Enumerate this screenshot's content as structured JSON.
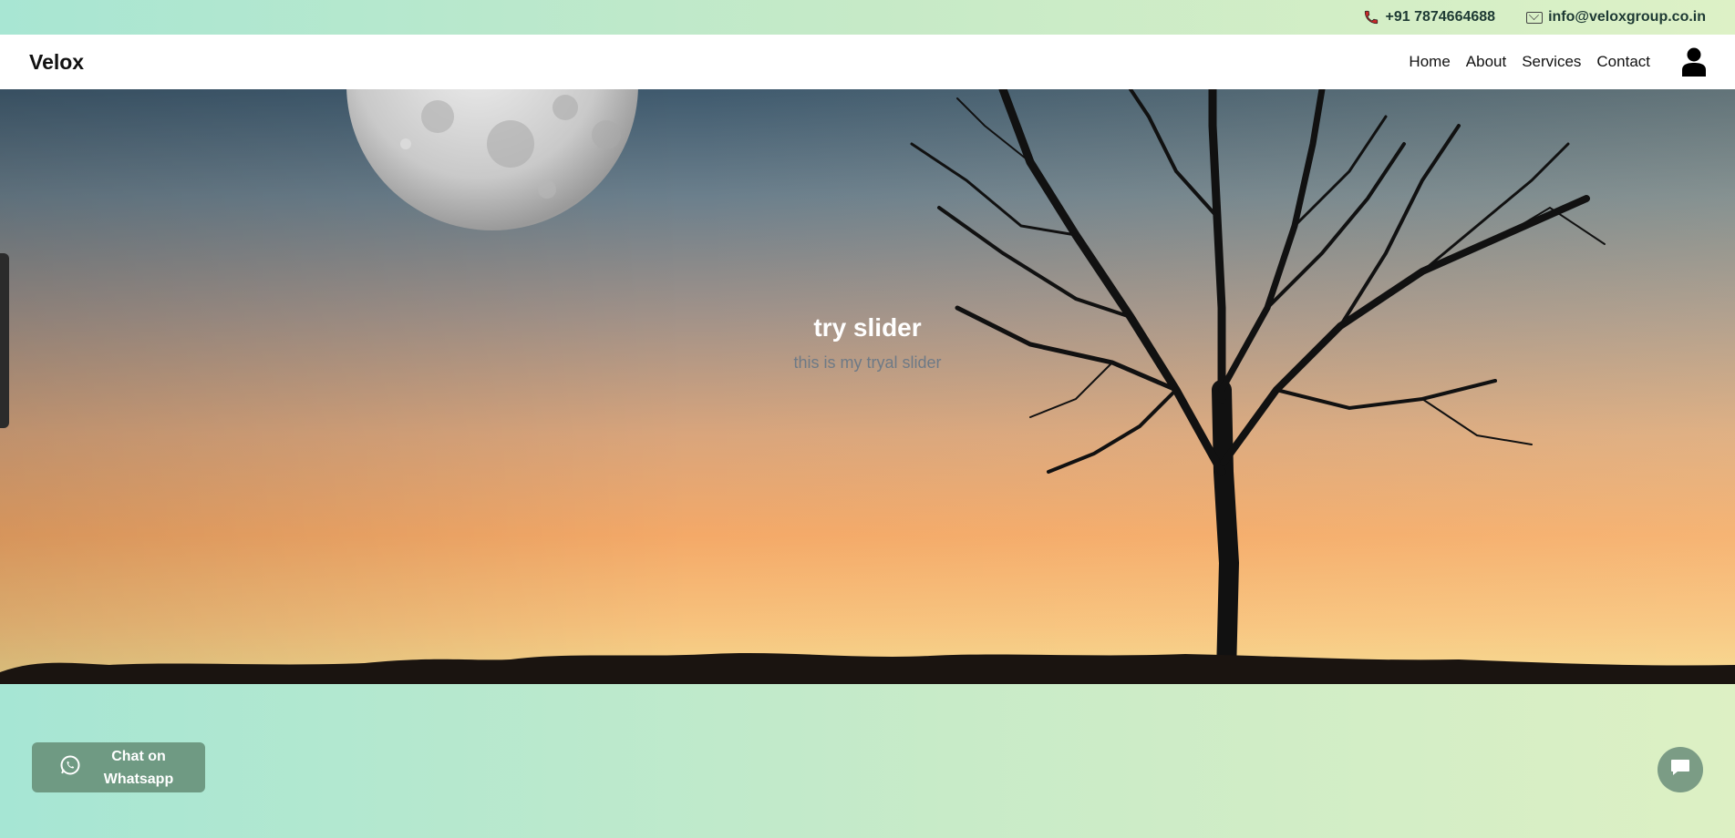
{
  "topbar": {
    "phone": "+91 7874664688",
    "email": "info@veloxgroup.co.in"
  },
  "navbar": {
    "brand": "Velox",
    "links": [
      "Home",
      "About",
      "Services",
      "Contact"
    ]
  },
  "hero": {
    "title": "try slider",
    "subtitle": "this is my tryal slider"
  },
  "whatsapp": {
    "label_line1": "Chat on",
    "label_line2": "Whatsapp"
  },
  "icons": {
    "phone": "phone-icon",
    "email": "mail-icon",
    "user": "user-icon",
    "whatsapp": "whatsapp-icon",
    "chat": "chat-bubble-icon"
  },
  "colors": {
    "topbar_start": "#a8e6d3",
    "topbar_end": "#ddf1c6",
    "whatsapp_button": "#6f9a83",
    "chat_button": "#7b9c85"
  }
}
